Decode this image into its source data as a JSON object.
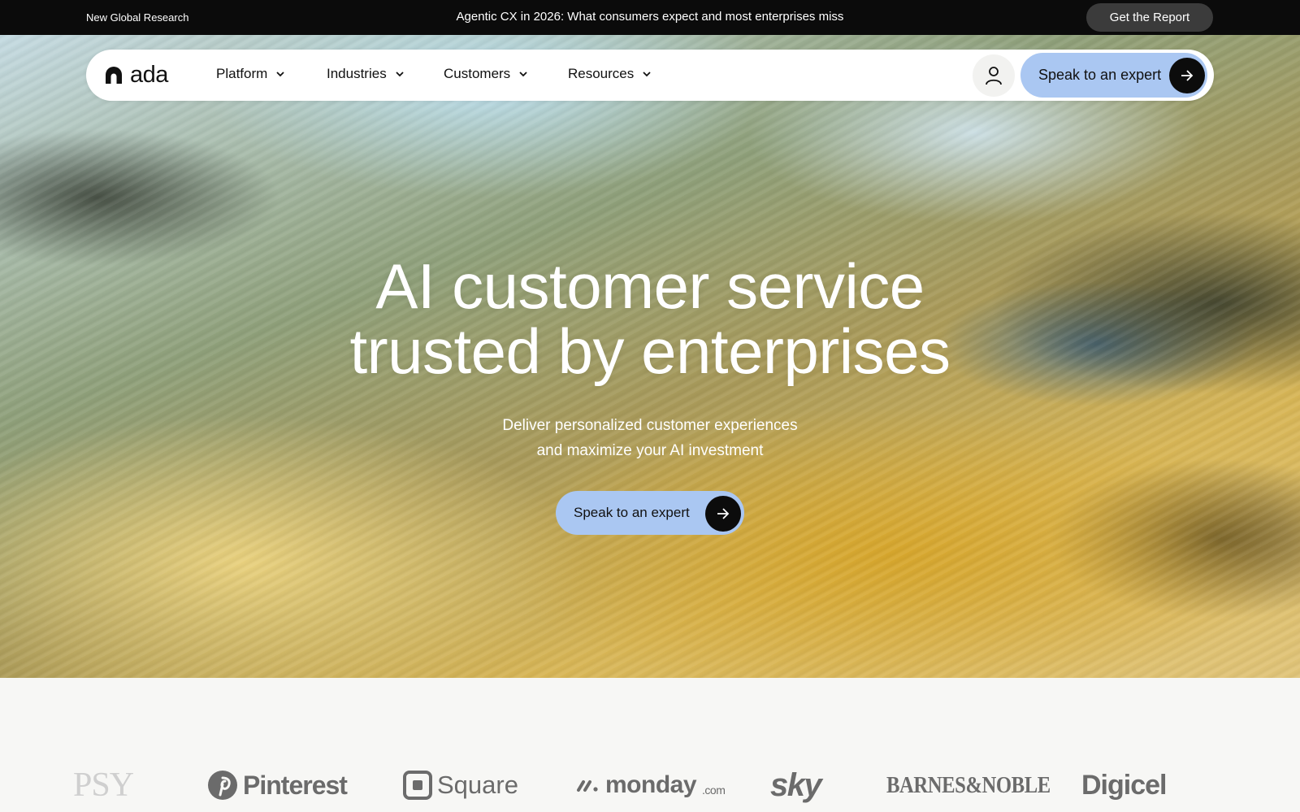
{
  "announcement": {
    "tag": "New Global Research",
    "headline": "Agentic CX in 2026: What consumers expect and most enterprises miss",
    "cta_label": "Get the Report"
  },
  "nav": {
    "logo_text": "ada",
    "items": [
      {
        "label": "Platform"
      },
      {
        "label": "Industries"
      },
      {
        "label": "Customers"
      },
      {
        "label": "Resources"
      }
    ],
    "account_icon": "user-icon",
    "cta_label": "Speak to an expert",
    "cta_icon": "arrow-right-icon"
  },
  "hero": {
    "title_line1": "AI customer service",
    "title_line2": "trusted by enterprises",
    "subtitle_line1": "Deliver personalized customer experiences",
    "subtitle_line2": "and maximize your AI investment",
    "cta_label": "Speak to an expert",
    "cta_icon": "arrow-right-icon"
  },
  "customer_logos": {
    "psy": "PSY",
    "pinterest": "Pinterest",
    "square": "Square",
    "monday": "monday",
    "monday_suffix": ".com",
    "sky": "sky",
    "barnes_noble": "BARNES&NOBLE",
    "digicel": "Digicel"
  },
  "colors": {
    "topbar_bg": "#0b0b0b",
    "cta_blue": "#aac7f2",
    "arrow_circle": "#0c0c0c",
    "logo_gray": "#6b6b6b"
  }
}
